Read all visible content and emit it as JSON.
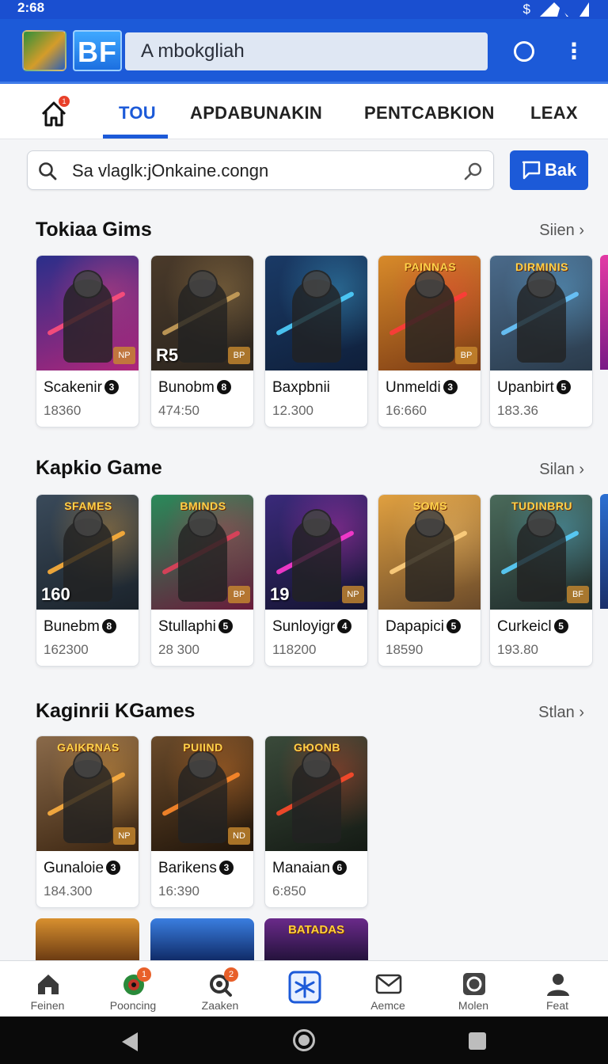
{
  "status_bar": {
    "time": "2:68"
  },
  "app_bar": {
    "logo_text": "BF",
    "title": "A mbokgliah"
  },
  "tabs": [
    {
      "label": "TOU",
      "active": true
    },
    {
      "label": "APDABUNAKIN",
      "active": false
    },
    {
      "label": "PENTCABKION",
      "active": false
    },
    {
      "label": "LEAX",
      "active": false
    }
  ],
  "search": {
    "value": "Sa vlaglk:jOnkaine.congn",
    "back_label": "Bak"
  },
  "sections": [
    {
      "title": "Tokiaa Gims",
      "link": "Siien",
      "cards": [
        {
          "name": "Scakenir",
          "badge": "3",
          "count": "18360",
          "tag": "NP",
          "corner": "",
          "banner": "",
          "theme": "a"
        },
        {
          "name": "Bunobm",
          "badge": "8",
          "count": "474:50",
          "tag": "BP",
          "corner": "R5",
          "banner": "",
          "theme": "b"
        },
        {
          "name": "Baxpbnii",
          "badge": "",
          "count": "12.300",
          "tag": "",
          "corner": "",
          "banner": "",
          "theme": "c"
        },
        {
          "name": "Unmeldi",
          "badge": "3",
          "count": "16:660",
          "tag": "BP",
          "corner": "",
          "banner": "PAINNAS",
          "theme": "d"
        },
        {
          "name": "Upanbirt",
          "badge": "5",
          "count": "183.36",
          "tag": "",
          "corner": "",
          "banner": "DIRMINIS",
          "theme": "e"
        }
      ]
    },
    {
      "title": "Kapkio Game",
      "link": "Silan",
      "cards": [
        {
          "name": "Bunebm",
          "badge": "8",
          "count": "162300",
          "tag": "",
          "corner": "160",
          "banner": "SFAMES",
          "theme": "f"
        },
        {
          "name": "Stullaphi",
          "badge": "5",
          "count": "28 300",
          "tag": "BP",
          "corner": "",
          "banner": "BMINDS",
          "theme": "g"
        },
        {
          "name": "Sunloyigr",
          "badge": "4",
          "count": "118200",
          "tag": "NP",
          "corner": "19",
          "banner": "",
          "theme": "h"
        },
        {
          "name": "Dapapici",
          "badge": "5",
          "count": "18590",
          "tag": "",
          "corner": "",
          "banner": "SOMS",
          "theme": "i"
        },
        {
          "name": "Curkeicl",
          "badge": "5",
          "count": "193.80",
          "tag": "BF",
          "corner": "",
          "banner": "TUDINBRU",
          "theme": "j"
        }
      ]
    },
    {
      "title": "Kaginrii KGames",
      "link": "Stlan",
      "cards": [
        {
          "name": "Gunaloie",
          "badge": "3",
          "count": "184.300",
          "tag": "NP",
          "corner": "",
          "banner": "GAIKRNAS",
          "theme": "k"
        },
        {
          "name": "Barikens",
          "badge": "3",
          "count": "16:390",
          "tag": "ND",
          "corner": "",
          "banner": "PUIIND",
          "theme": "l"
        },
        {
          "name": "Manaian",
          "badge": "6",
          "count": "6:850",
          "tag": "",
          "corner": "",
          "banner": "GЮONB",
          "theme": "m"
        }
      ]
    }
  ],
  "peek_cards": [
    {
      "banner": ""
    },
    {
      "banner": ""
    },
    {
      "banner": "BATADAS"
    }
  ],
  "bottom_nav": [
    {
      "label": "Feinen",
      "icon": "home-icon",
      "badge": ""
    },
    {
      "label": "Pooncing",
      "icon": "game-controller-icon",
      "badge": "1"
    },
    {
      "label": "Zaaken",
      "icon": "search-badge-icon",
      "badge": "2"
    },
    {
      "label": "",
      "icon": "star-icon",
      "badge": ""
    },
    {
      "label": "Aemce",
      "icon": "mail-icon",
      "badge": ""
    },
    {
      "label": "Molen",
      "icon": "camera-icon",
      "badge": ""
    },
    {
      "label": "Feat",
      "icon": "profile-icon",
      "badge": ""
    }
  ],
  "colors": {
    "primary": "#1c5ad8",
    "badge": "#e8402a"
  }
}
